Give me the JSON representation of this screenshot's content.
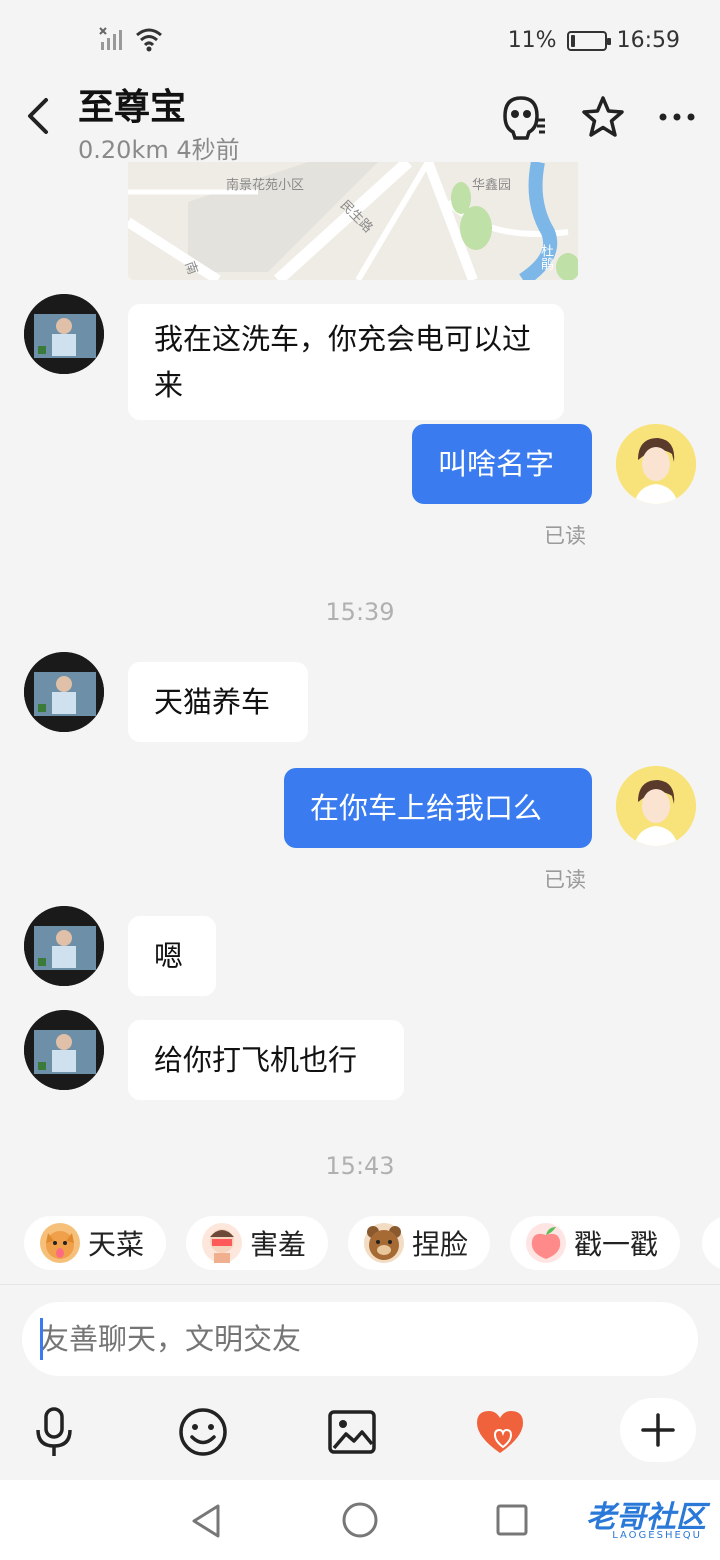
{
  "status_bar": {
    "battery": "11%",
    "battery_level": 0.11,
    "time": "16:59"
  },
  "header": {
    "title": "至尊宝",
    "subtitle": "0.20km 4秒前"
  },
  "map": {
    "labels": [
      "南景花苑小区",
      "华鑫园",
      "民生路",
      "杜鹃",
      "南"
    ]
  },
  "messages": [
    {
      "from": "them",
      "text": "我在这洗车，你充会电可以过来"
    },
    {
      "from": "me",
      "text": "叫啥名字",
      "status": "已读"
    },
    {
      "type": "time",
      "text": "15:39"
    },
    {
      "from": "them",
      "text": "天猫养车"
    },
    {
      "from": "me",
      "text": "在你车上给我口么",
      "status": "已读"
    },
    {
      "from": "them",
      "text": "嗯"
    },
    {
      "from": "them",
      "text": "给你打飞机也行"
    },
    {
      "type": "time",
      "text": "15:43"
    }
  ],
  "quick_replies": [
    {
      "label": "天菜",
      "icon": "dog-emoji-icon"
    },
    {
      "label": "害羞",
      "icon": "shy-emoji-icon"
    },
    {
      "label": "捏脸",
      "icon": "bear-emoji-icon"
    },
    {
      "label": "戳一戳",
      "icon": "peach-emoji-icon"
    }
  ],
  "input": {
    "placeholder": "友善聊天，文明交友"
  },
  "watermark": {
    "text": "老哥社区",
    "sub": "LAOGESHEQU"
  },
  "colors": {
    "accent": "#3a7cf0",
    "background": "#f4f4f4",
    "heart": "#f0623c"
  }
}
